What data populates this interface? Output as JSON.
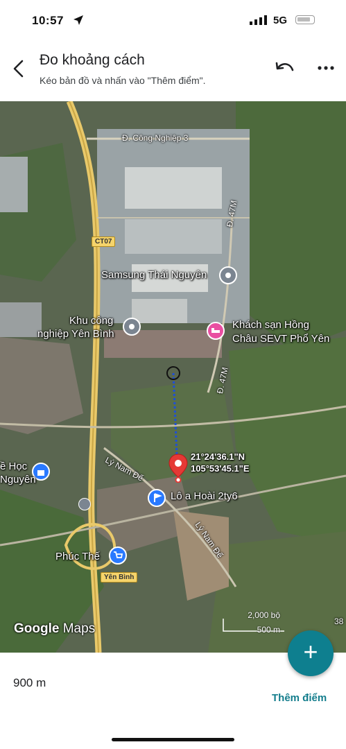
{
  "status_bar": {
    "time": "10:57",
    "network": "5G"
  },
  "header": {
    "title": "Đo khoảng cách",
    "subtitle": "Kéo bản đồ và nhấn vào \"Thêm điểm\"."
  },
  "map": {
    "places": {
      "samsung": "Samsung Thái Nguyên",
      "kcn_line1": "Khu công",
      "kcn_line2": "nghiệp Yên Bình",
      "hotel_line1": "Khách sạn Hồng",
      "hotel_line2": "Châu SEVT Phổ Yên",
      "lo_a_hoai": "Lô a Hoài 2ty6",
      "phuc_the": "Phúc Thế",
      "school_line1": "ề Học",
      "school_line2": "Nguyên"
    },
    "roads": {
      "cong_nghiep_3": "Đ. Công Nghiệp 3",
      "d47m_upper": "Đ. 47M",
      "d47m_lower": "Đ. 47M",
      "ly_nam_de_1": "Lý Nam Đế",
      "ly_nam_de_2": "Lý Nam Đế",
      "ct07": "CT07",
      "yen_binh": "Yên Bình",
      "edge_38": "38"
    },
    "pin": {
      "lat": "21°24'36.1\"N",
      "lng": "105°53'45.1\"E"
    },
    "scale": {
      "imperial": "2,000 bộ",
      "metric": "500 m"
    },
    "attribution": {
      "google": "Google",
      "maps": "Maps"
    },
    "colors": {
      "pin_red": "#e53935",
      "measure_line": "#1e4fd8",
      "poi_gray": "#7b8591",
      "poi_pink": "#e94fa1",
      "poi_blue": "#2979ff"
    }
  },
  "footer": {
    "distance": "900 m",
    "add_point_label": "Thêm điểm",
    "fab_icon": "plus-icon"
  }
}
